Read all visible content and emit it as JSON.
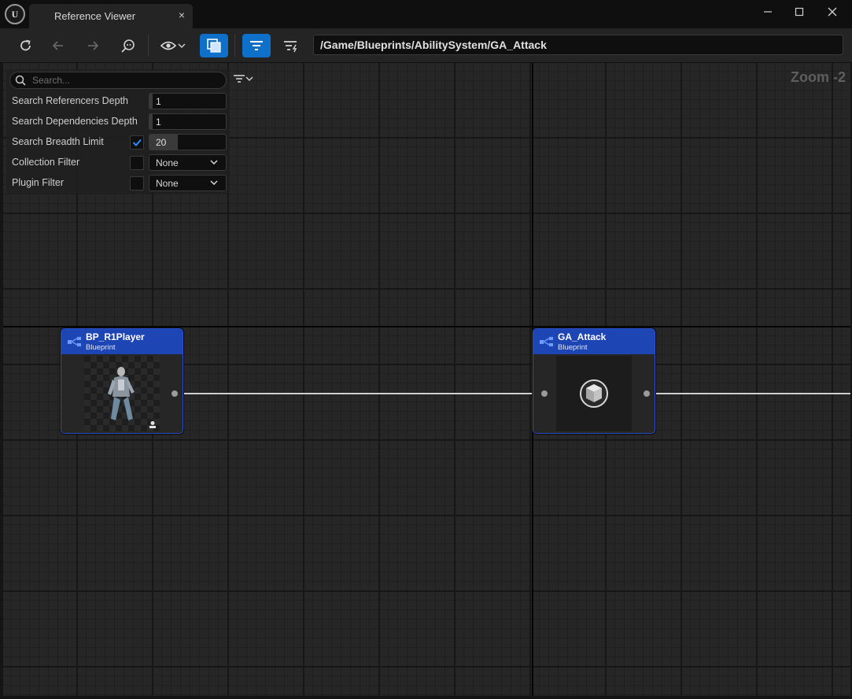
{
  "window": {
    "tab_title": "Reference Viewer",
    "tab_close": "×",
    "minimize": "—",
    "maximize": "☐",
    "close": "✕"
  },
  "toolbar": {
    "path": "/Game/Blueprints/AbilitySystem/GA_Attack",
    "icons": [
      "refresh-icon",
      "back-arrow-icon",
      "forward-arrow-icon",
      "find-path-icon",
      "eye-icon",
      "show-duplicates-icon",
      "filter-icon",
      "settings-filter-icon"
    ],
    "accent": "#0e70c8"
  },
  "graph": {
    "zoom_label": "Zoom -2"
  },
  "filters": {
    "search_placeholder": "Search...",
    "referencers_depth_label": "Search Referencers Depth",
    "referencers_depth_value": "1",
    "dependencies_depth_label": "Search Dependencies Depth",
    "dependencies_depth_value": "1",
    "breadth_limit_label": "Search Breadth Limit",
    "breadth_limit_checked": true,
    "breadth_limit_value": "20",
    "collection_filter_label": "Collection Filter",
    "collection_filter_value": "None",
    "plugin_filter_label": "Plugin Filter",
    "plugin_filter_value": "None"
  },
  "nodes": [
    {
      "title": "BP_R1Player",
      "type": "Blueprint",
      "thumbnail": "character-thumbnail"
    },
    {
      "title": "GA_Attack",
      "type": "Blueprint",
      "thumbnail": "blueprint-cube-icon"
    }
  ]
}
